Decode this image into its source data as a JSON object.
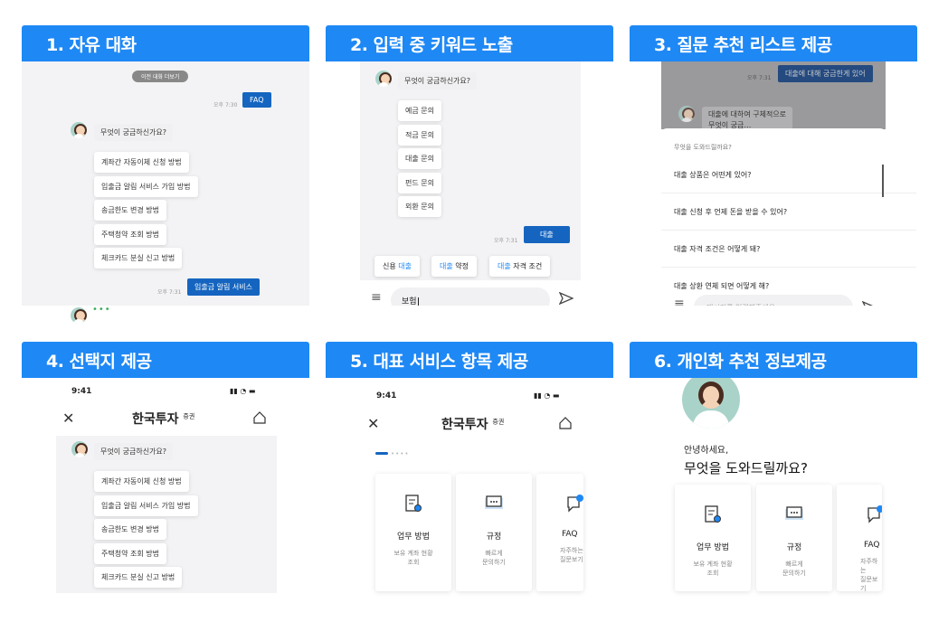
{
  "panels": [
    {
      "title": "1. 자유 대화"
    },
    {
      "title": "2. 입력 중 키워드 노출"
    },
    {
      "title": "3. 질문 추천 리스트 제공"
    },
    {
      "title": "4. 선택지 제공"
    },
    {
      "title": "5. 대표 서비스 항목 제공"
    },
    {
      "title": "6. 개인화  추천 정보제공"
    }
  ],
  "p1": {
    "prev_label": "이전 대화 더보기",
    "time1": "오후 7:30",
    "faq_label": "FAQ",
    "question": "무엇이 궁금하신가요?",
    "options": [
      "계좌간 자동이체 신청 방법",
      "입출금 알림 서비스 가입 방법",
      "송금한도 변경 방법",
      "주택청약 조회 방법",
      "체크카드 분실 신고 방법"
    ],
    "time2": "오후 7:31",
    "sent": "입출금 알림 서비스",
    "typing": "•••"
  },
  "p2": {
    "question": "무엇이 궁금하신가요?",
    "options": [
      "예금 문의",
      "적금 문의",
      "대출 문의",
      "펀드 문의",
      "외환 문의"
    ],
    "time": "오후 7:31",
    "sent": "대출",
    "chips": [
      {
        "pre": "신용 ",
        "kw": "대출",
        "post": ""
      },
      {
        "pre": "",
        "kw": "대출",
        "post": " 약정"
      },
      {
        "pre": "",
        "kw": "대출",
        "post": " 자격 조건"
      }
    ],
    "input_value": "보험"
  },
  "p3": {
    "time": "오후 7:31",
    "sent": "대출에 대해 궁금한게 있어",
    "bot_text": "대출에 대하여 구체적으로",
    "bot_text2": "무엇이 궁금…",
    "sheet_title": "무엇을 도와드릴까요?",
    "items": [
      "대출 상품은 어떤게 있어?",
      "대출 신청 후 언제 돈을 받을 수 있어?",
      "대출 자격 조건은 어떻게 돼?",
      "대출 상환 연체 되면 어떻게 해?"
    ],
    "placeholder": "메시지를 입력해주세요."
  },
  "p4": {
    "clock": "9:41",
    "brand": "한국투자",
    "brand_sup": "증권",
    "question": "무엇이 궁금하신가요?",
    "options": [
      "계좌간 자동이체 신청 방법",
      "입출금 알림 서비스 가입 방법",
      "송금한도 변경 방법",
      "주택청약 조회 방법",
      "체크카드 분실 신고 방법"
    ]
  },
  "p5": {
    "clock": "9:41",
    "brand": "한국투자",
    "brand_sup": "증권",
    "cards": [
      {
        "title": "업무 방법",
        "sub": "보유 계좌 현황\n조회"
      },
      {
        "title": "규정",
        "sub": "빠르게\n문의하기"
      },
      {
        "title": "FAQ",
        "sub": "자주하는\n질문보기"
      }
    ]
  },
  "p6": {
    "greet": "안녕하세요,",
    "headline": "무엇을 도와드릴까요?",
    "cards": [
      {
        "title": "업무 방법",
        "sub": "보유 계좌 현황\n조회"
      },
      {
        "title": "규정",
        "sub": "빠르게\n문의하기"
      },
      {
        "title": "FAQ",
        "sub": "자주하는\n질문보기"
      }
    ]
  },
  "colors": {
    "header": "#1e88f5",
    "user_bubble": "#1565c0",
    "keyword": "#1e88f5"
  }
}
